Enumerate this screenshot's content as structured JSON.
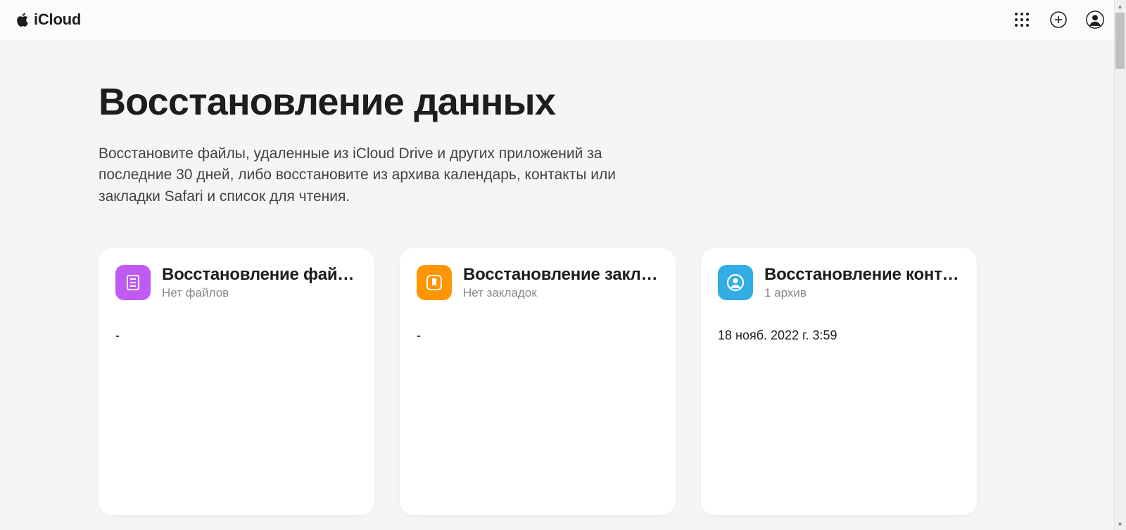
{
  "header": {
    "brand": "iCloud"
  },
  "page": {
    "title": "Восстановление данных",
    "description": "Восстановите файлы, удаленные из iCloud Drive и других приложений за последние 30 дней, либо восстановите из архива календарь, контакты или закладки Safari и список для чтения."
  },
  "cards": {
    "files": {
      "title": "Восстановление файл…",
      "subtitle": "Нет файлов",
      "body": "-"
    },
    "bookmarks": {
      "title": "Восстановление закла…",
      "subtitle": "Нет закладок",
      "body": "-"
    },
    "contacts": {
      "title": "Восстановление конта…",
      "subtitle": "1 архив",
      "body": "18 нояб. 2022 г. 3:59"
    }
  }
}
